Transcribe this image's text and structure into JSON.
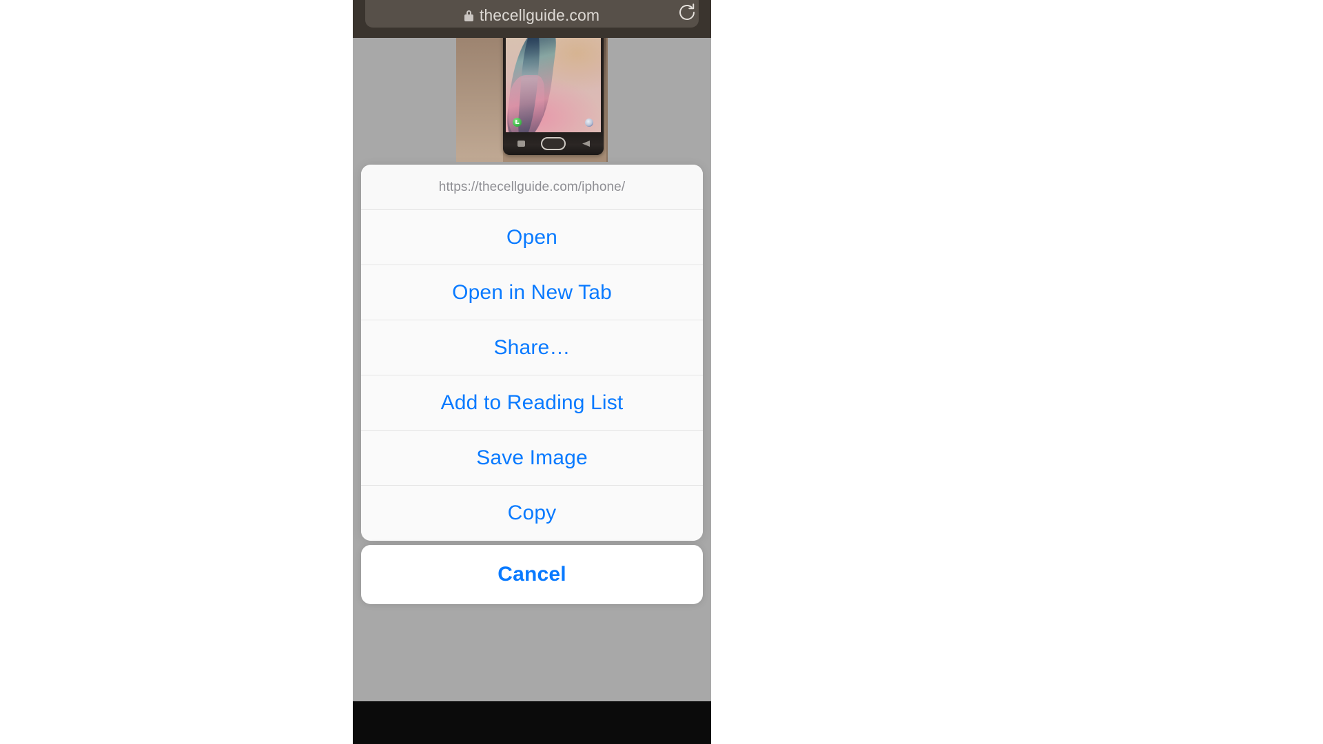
{
  "browser": {
    "lock_icon": "lock-icon",
    "url_display": "thecellguide.com",
    "reload_icon": "reload-icon"
  },
  "page": {
    "product_photo_alt": "gold samsung phone on table"
  },
  "action_sheet": {
    "url": "https://thecellguide.com/iphone/",
    "items": [
      {
        "label": "Open",
        "name": "open"
      },
      {
        "label": "Open in New Tab",
        "name": "open-in-new-tab"
      },
      {
        "label": "Share…",
        "name": "share"
      },
      {
        "label": "Add to Reading List",
        "name": "add-to-reading-list"
      },
      {
        "label": "Save Image",
        "name": "save-image"
      },
      {
        "label": "Copy",
        "name": "copy"
      }
    ],
    "cancel_label": "Cancel",
    "accent_color": "#097aff",
    "url_text_color": "#8e8e93"
  }
}
